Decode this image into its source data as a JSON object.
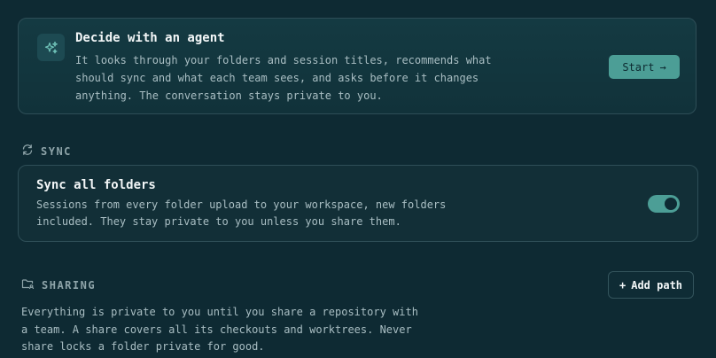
{
  "agent": {
    "title": "Decide with an agent",
    "description": "It looks through your folders and session titles, recommends what should sync and what each team sees, and asks before it changes anything. The conversation stays private to you.",
    "start_label": "Start",
    "start_arrow": "→",
    "icon": "sparkles-icon"
  },
  "sync": {
    "header": "SYNC",
    "icon": "refresh-icon",
    "card_title": "Sync all folders",
    "card_description": "Sessions from every folder upload to your workspace, new folders included. They stay private to you unless you share them.",
    "toggle_on": true
  },
  "sharing": {
    "header": "SHARING",
    "icon": "folder-share-icon",
    "add_path_plus": "+",
    "add_path_label": "Add path",
    "description": "Everything is private to you until you share a repository with a team. A share covers all its checkouts and worktrees. Never share locks a folder private for good."
  },
  "colors": {
    "background": "#0e2a33",
    "accent": "#4c9e96",
    "card_border": "#2e4e57"
  }
}
